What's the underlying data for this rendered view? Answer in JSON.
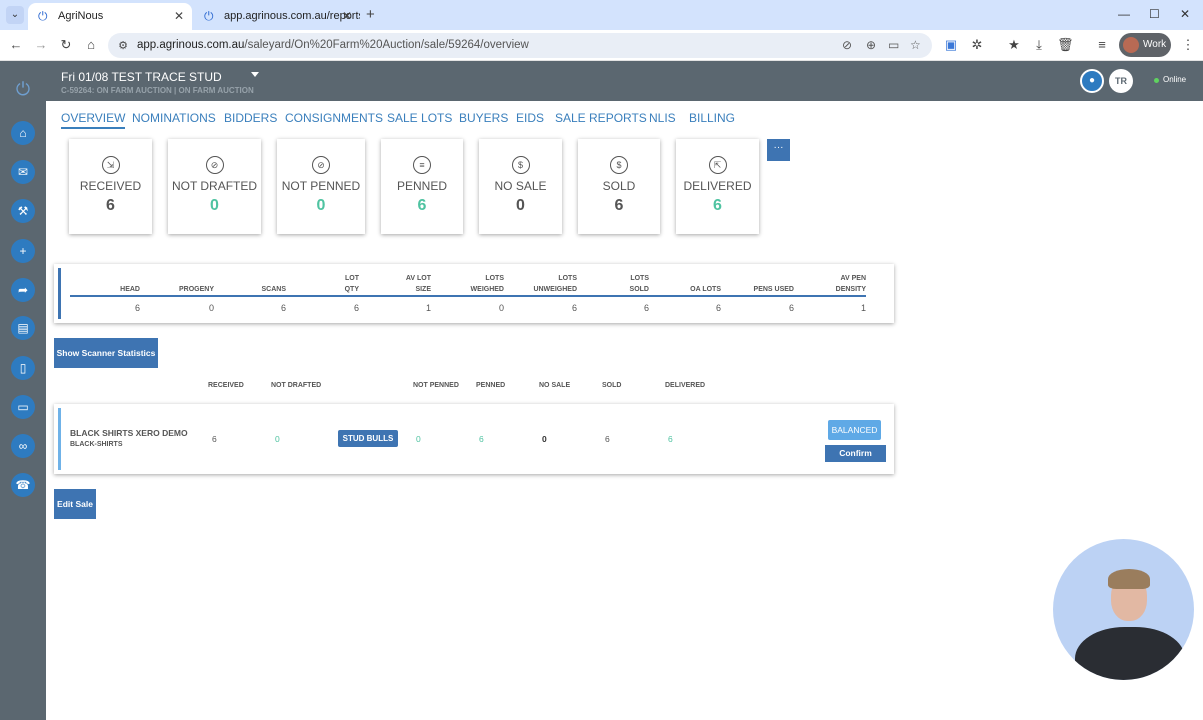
{
  "browser": {
    "tabs": [
      {
        "title": "AgriNous",
        "active": true
      },
      {
        "title": "app.agrinous.com.au/reports/s",
        "active": false
      }
    ],
    "url_host": "app.agrinous.com.au",
    "url_path": "/saleyard/On%20Farm%20Auction/sale/59264/overview",
    "profile": "Work"
  },
  "header": {
    "sale_title": "Fri 01/08 TEST TRACE STUD",
    "sale_subtitle": "C-59264: ON FARM AUCTION | ON FARM AUCTION",
    "user_initials": "TR",
    "status": "Online"
  },
  "nav_tabs": [
    "OVERVIEW",
    "NOMINATIONS",
    "BIDDERS",
    "CONSIGNMENTS",
    "SALE LOTS",
    "BUYERS",
    "EIDS",
    "SALE REPORTS",
    "NLIS",
    "BILLING"
  ],
  "more_button": "···",
  "stats": [
    {
      "label": "RECEIVED",
      "value": "6",
      "color": "#555555"
    },
    {
      "label": "NOT DRAFTED",
      "value": "0",
      "color": "#4fc3a1"
    },
    {
      "label": "NOT PENNED",
      "value": "0",
      "color": "#4fc3a1"
    },
    {
      "label": "PENNED",
      "value": "6",
      "color": "#4fc3a1"
    },
    {
      "label": "NO SALE",
      "value": "0",
      "color": "#555555"
    },
    {
      "label": "SOLD",
      "value": "6",
      "color": "#555555"
    },
    {
      "label": "DELIVERED",
      "value": "6",
      "color": "#4fc3a1"
    }
  ],
  "summary": {
    "columns": [
      {
        "l1": "",
        "l2": "HEAD",
        "value": "6"
      },
      {
        "l1": "",
        "l2": "PROGENY",
        "value": "0"
      },
      {
        "l1": "",
        "l2": "SCANS",
        "value": "6"
      },
      {
        "l1": "LOT",
        "l2": "QTY",
        "value": "6"
      },
      {
        "l1": "AV LOT",
        "l2": "SIZE",
        "value": "1"
      },
      {
        "l1": "LOTS",
        "l2": "WEIGHED",
        "value": "0"
      },
      {
        "l1": "LOTS",
        "l2": "UNWEIGHED",
        "value": "6"
      },
      {
        "l1": "LOTS",
        "l2": "SOLD",
        "value": "6"
      },
      {
        "l1": "",
        "l2": "OA LOTS",
        "value": "6"
      },
      {
        "l1": "",
        "l2": "PENS USED",
        "value": "6"
      },
      {
        "l1": "AV PEN",
        "l2": "DENSITY",
        "value": "1"
      }
    ]
  },
  "scanner_button": "Show Scanner Statistics",
  "consignment_headers": [
    "RECEIVED",
    "NOT DRAFTED",
    "NOT PENNED",
    "PENNED",
    "NO SALE",
    "SOLD",
    "DELIVERED"
  ],
  "consignment": {
    "name": "BLACK SHIRTS XERO DEMO",
    "code": "BLACK-SHIRTS",
    "received": "6",
    "not_drafted": "0",
    "category": "STUD BULLS",
    "not_penned": "0",
    "penned": "6",
    "no_sale": "0",
    "sold": "6",
    "delivered": "6",
    "balanced_label": "BALANCED",
    "confirm_label": "Confirm"
  },
  "edit_button": "Edit Sale"
}
